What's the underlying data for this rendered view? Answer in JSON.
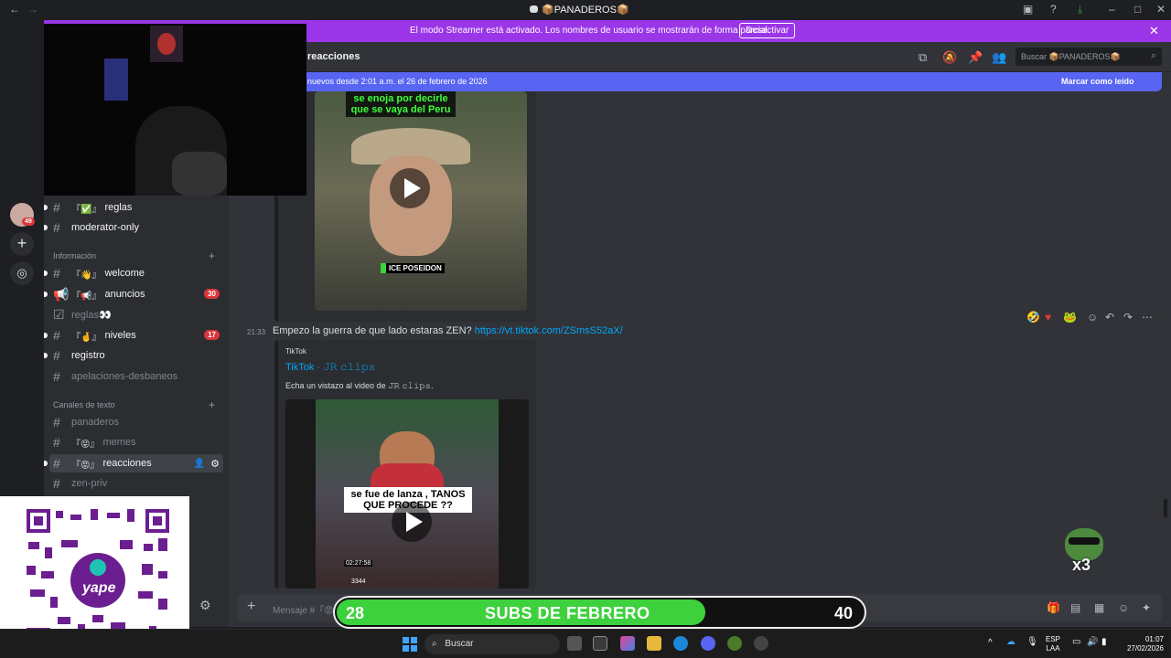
{
  "window": {
    "title": "📦PANADEROS📦",
    "back_icon": "←",
    "forward_icon": "→"
  },
  "streamer_banner": {
    "text": "El modo Streamer está activado. Los nombres de usuario se mostrarán de forma parcial.",
    "button": "Desactivar",
    "color": "#9b36e8"
  },
  "rail": {
    "badge_count": "49"
  },
  "sidebar": {
    "channels_top": [
      {
        "deco": "『✅』",
        "name": "reglas"
      },
      {
        "deco": "",
        "name": "moderator-only"
      }
    ],
    "cat_info": "Información",
    "channels_info": [
      {
        "deco": "『👋』",
        "name": "welcome"
      },
      {
        "deco": "『📢』",
        "name": "anuncios",
        "badge": "30"
      },
      {
        "deco": "",
        "name": "reglas👀"
      },
      {
        "deco": "『🤞』",
        "name": "niveles",
        "badge": "17"
      },
      {
        "deco": "",
        "name": "registro"
      },
      {
        "deco": "",
        "name": "apelaciones-desbaneos"
      }
    ],
    "cat_text": "Canales de texto",
    "channels_text": [
      {
        "deco": "",
        "name": "panaderos"
      },
      {
        "deco": "『😝』",
        "name": "memes"
      },
      {
        "deco": "『😡』",
        "name": "reacciones"
      },
      {
        "deco": "",
        "name": "zen-priv"
      }
    ]
  },
  "header": {
    "channel": "reacciones",
    "search_placeholder": "Buscar 📦PANADEROS📦"
  },
  "new_messages_bar": {
    "text": "nuevos desde 2:01 a.m. el 26 de febrero de 2026",
    "action": "Marcar como leído"
  },
  "messages": [
    {
      "video_caption": "se enoja por decirle que se vaya del Peru",
      "watermark": "ICE POSEIDON"
    },
    {
      "time": "21:33",
      "text": "Empezo la guerra de que lado estaras ZEN?",
      "link": "https://vt.tiktok.com/ZSmsS52aX/",
      "embed_provider": "TikTok",
      "embed_title": "TikTok · 𝙹𝚁 𝚌𝚕𝚒𝚙𝚜",
      "embed_desc": "Echa un vistazo al video de 𝙹𝚁 𝚌𝚕𝚒𝚙𝚜.",
      "video_caption": "se fue de lanza , TANOS QUE PROCEDE ??",
      "video_time": "02:27:58",
      "video_id": "3344"
    }
  ],
  "composer": {
    "placeholder": "Mensaje #『😡』reacciones"
  },
  "overlay": {
    "qr_brand": "yape",
    "subs_current": "28",
    "subs_label": "SUBS DE FEBRERO",
    "subs_goal": "40",
    "subs_fraction": 0.7,
    "pepe_multiplier": "x3"
  },
  "taskbar": {
    "search": "Buscar",
    "lang_top": "ESP",
    "lang_bottom": "LAA",
    "time": "01:07",
    "date": "27/02/2026"
  }
}
